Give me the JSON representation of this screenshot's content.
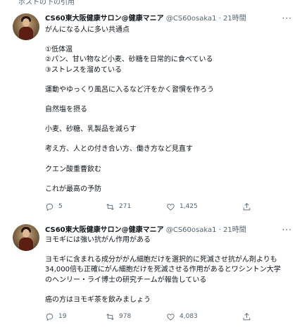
{
  "top_fragment": {
    "text": "ポストの下の引用",
    "more": "···"
  },
  "tweets": [
    {
      "name": "CS60東大阪健康サロン@健康マニア",
      "handle": "@CS60osaka1",
      "dot": "·",
      "time": "21時間",
      "menu": "···",
      "lines": [
        "がんになる人に多い共通点",
        "",
        "①低体温",
        "②パン、甘い物など小麦、砂糖を日常的に食べている",
        "③ストレスを溜めている",
        "",
        "運動やゆっくり風呂に入るなど汗をかく習慣を作ろう",
        "",
        "自然塩を摂る",
        "",
        "小麦、砂糖、乳製品を減らす",
        "",
        "考え方、人との付き合い方、働き方など見直す",
        "",
        "クエン酸重曹飲む",
        "",
        "これが最高の予防"
      ],
      "replies": "5",
      "retweets": "271",
      "likes": "1,425"
    },
    {
      "name": "CS60東大阪健康サロン@健康マニア",
      "handle": "@CS60osaka1",
      "dot": "·",
      "time": "21時間",
      "menu": "···",
      "lines": [
        "ヨモギには強い抗がん作用がある",
        "",
        "ヨモギに含まれる成分ががん細胞だけを選択的に死滅させ抗がん剤よりも",
        "34,000倍も正確にがん細胞だけを死滅させる作用があるとワシントン大学",
        "のヘンリー・ライ博士の研究チームが報告している",
        "",
        "癌の方はヨモギ茶を飲みましょう"
      ],
      "replies": "19",
      "retweets": "978",
      "likes": "4,083"
    }
  ],
  "icons": {
    "reply": "reply-icon",
    "retweet": "retweet-icon",
    "like": "heart-icon",
    "share": "share-icon"
  },
  "colors": {
    "text": "#0f1419",
    "secondary": "#536471",
    "divider": "#eff3f4"
  }
}
